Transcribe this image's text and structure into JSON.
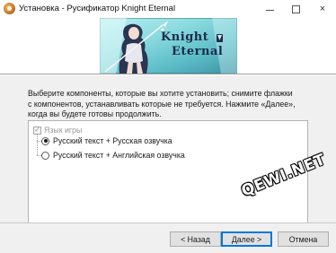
{
  "window": {
    "title": "Установка - Русификатор Knight Eternal",
    "icon": "installer-app-icon",
    "controls": {
      "minimize": "minimize-icon",
      "maximize": "maximize-icon",
      "close": "×"
    }
  },
  "banner": {
    "logo_line1": "Knight",
    "logo_line2": "Eternal"
  },
  "main": {
    "description": "Выберите компоненты, которые вы хотите установить; снимите флажки с компонентов, устанавливать которые не требуется. Нажмите «Далее», когда вы будете готовы продолжить.",
    "components": {
      "group_label": "Язык игры",
      "group_checked": true,
      "group_disabled": true,
      "options": [
        {
          "label": "Русский текст + Русская озвучка",
          "selected": true
        },
        {
          "label": "Русский текст + Английская озвучка",
          "selected": false
        }
      ]
    }
  },
  "watermark": "QEWI.NET",
  "footer": {
    "back_label": "< Назад",
    "next_label": "Далее >",
    "cancel_label": "Отмена"
  },
  "colors": {
    "accent": "#0078d7",
    "panel_bg": "#f0f0f0",
    "button_bg": "#e1e1e1",
    "banner_teal": "#5bbcc7"
  }
}
